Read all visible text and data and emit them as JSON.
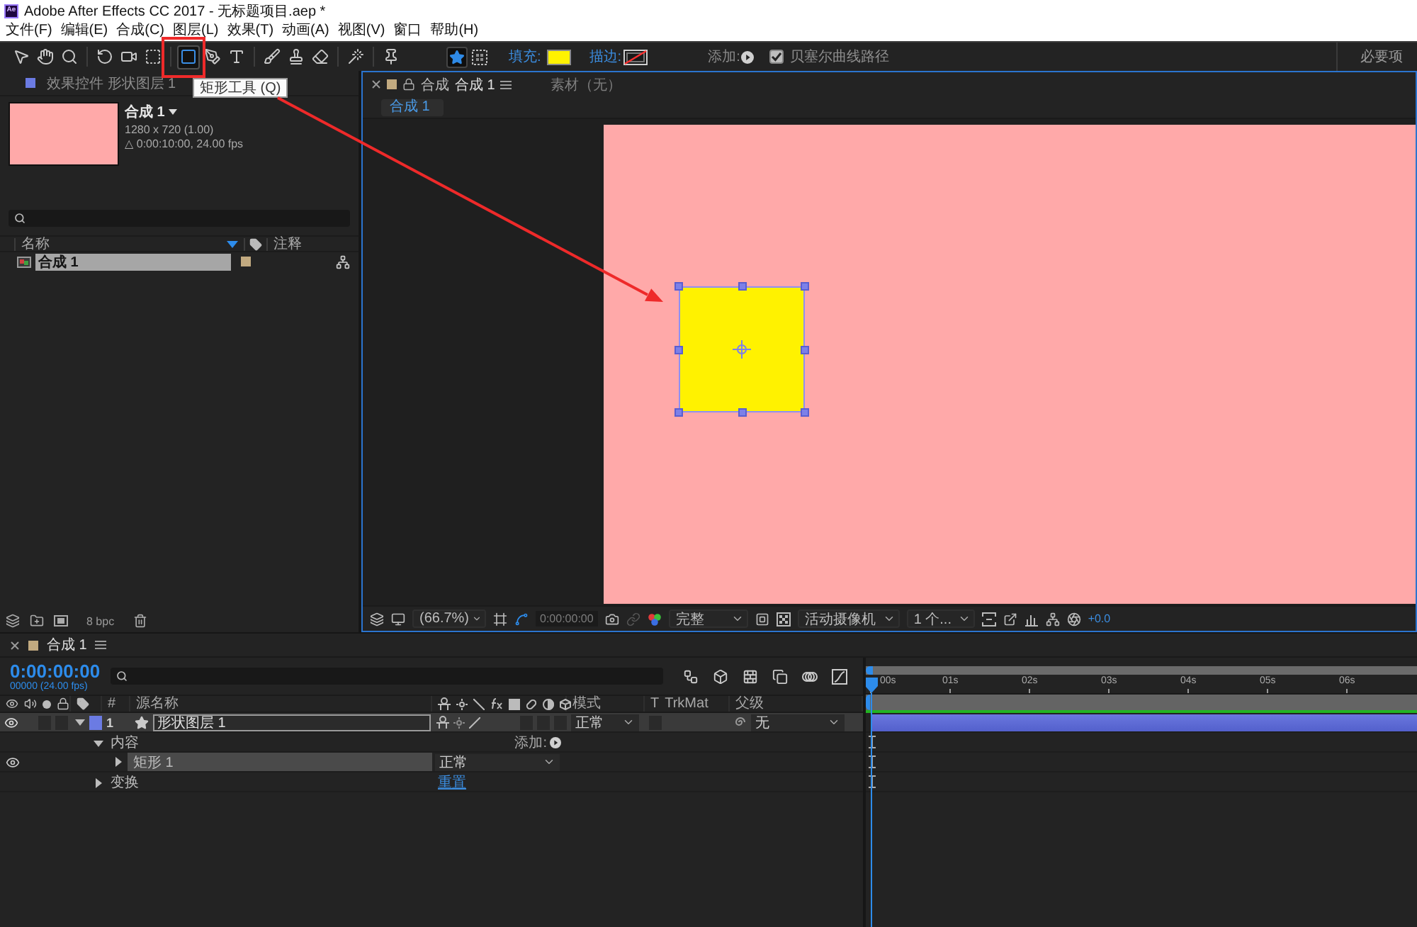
{
  "window": {
    "logo": "Ae",
    "title": "Adobe After Effects CC 2017 - 无标题项目.aep *"
  },
  "menu": [
    "文件(F)",
    "编辑(E)",
    "合成(C)",
    "图层(L)",
    "效果(T)",
    "动画(A)",
    "视图(V)",
    "窗口",
    "帮助(H)"
  ],
  "toolbar": {
    "tools": [
      {
        "kind": "arrow",
        "selected": false
      },
      {
        "kind": "hand",
        "selected": false
      },
      {
        "kind": "zoom",
        "selected": false
      },
      {
        "kind": "rotate",
        "selected": false
      },
      {
        "kind": "camera",
        "selected": false
      },
      {
        "kind": "pan",
        "selected": false
      },
      {
        "kind": "rectangle",
        "selected": true
      },
      {
        "kind": "pen",
        "selected": false
      },
      {
        "kind": "text",
        "selected": false
      },
      {
        "kind": "brush",
        "selected": false
      },
      {
        "kind": "stamp",
        "selected": false
      },
      {
        "kind": "eraser",
        "selected": false
      },
      {
        "kind": "roto",
        "selected": false
      },
      {
        "kind": "pin",
        "selected": false
      }
    ],
    "shape_modes": [
      {
        "kind": "star",
        "selected": true
      },
      {
        "kind": "mask",
        "selected": false
      }
    ],
    "fill": {
      "label": "填充:",
      "color": "#fff200"
    },
    "stroke": {
      "label": "描边:"
    },
    "add": {
      "label": "添加:"
    },
    "bezier": {
      "label": "贝塞尔曲线路径",
      "checked": true
    },
    "workspace": "必要项"
  },
  "tooltip": "矩形工具 (Q)",
  "effects_panel": {
    "title": "效果控件 形状图层 1"
  },
  "project": {
    "comp": {
      "name": "合成 1",
      "size": "1280 x 720 (1.00)",
      "duration": "△ 0:00:10:00, 24.00 fps"
    },
    "columns": [
      "名称",
      "注释"
    ],
    "items": [
      {
        "name": "合成 1",
        "selected": true
      }
    ],
    "bit_depth": "8 bpc"
  },
  "composition": {
    "tabs": [
      {
        "label": "合成",
        "name": "合成 1",
        "selected": true
      },
      {
        "label": "素材（无）",
        "selected": false
      }
    ],
    "breadcrumb": "合成 1"
  },
  "viewer_bar": {
    "zoom": "(66.7%)",
    "timecode": "0:00:00:00",
    "resolution": "完整",
    "camera": "活动摄像机",
    "views": "1 个...",
    "exposure": "+0.0"
  },
  "timeline": {
    "tab": "合成 1",
    "timecode": "0:00:00:00",
    "frame_info": "00000 (24.00 fps)",
    "columns": [
      "#",
      "源名称",
      "模式",
      "T",
      "TrkMat",
      "父级"
    ],
    "layers": [
      {
        "number": "1",
        "name": "形状图层 1",
        "visible": true,
        "expanded": true,
        "color": "#6b7be3",
        "mode": "正常",
        "parent": "无",
        "children": [
          {
            "kind": "contents",
            "name": "内容",
            "expanded": true,
            "action": "添加:",
            "children": [
              {
                "kind": "shape",
                "name": "矩形 1",
                "visible": true,
                "expanded": false,
                "mode": "正常"
              }
            ]
          },
          {
            "kind": "transform",
            "name": "变换",
            "expanded": false,
            "link": "重置"
          }
        ]
      }
    ],
    "ruler": [
      "00s",
      "01s",
      "02s",
      "03s",
      "04s",
      "05s",
      "06s"
    ]
  }
}
